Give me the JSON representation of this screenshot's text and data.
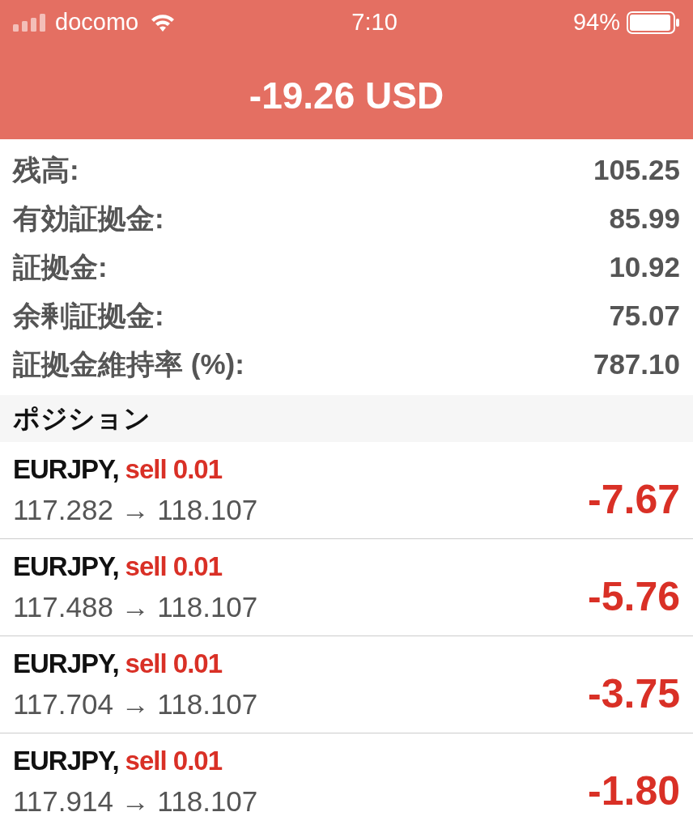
{
  "status_bar": {
    "carrier": "docomo",
    "time": "7:10",
    "battery": "94%"
  },
  "header": {
    "title": "-19.26 USD"
  },
  "summary": [
    {
      "label": "残高:",
      "value": "105.25"
    },
    {
      "label": "有効証拠金:",
      "value": "85.99"
    },
    {
      "label": "証拠金:",
      "value": "10.92"
    },
    {
      "label": "余剰証拠金:",
      "value": "75.07"
    },
    {
      "label": "証拠金維持率 (%):",
      "value": "787.10"
    }
  ],
  "section": {
    "title": "ポジション"
  },
  "positions": [
    {
      "symbol": "EURJPY,",
      "order": "sell 0.01",
      "prices": "117.282 → 118.107",
      "profit": "-7.67"
    },
    {
      "symbol": "EURJPY,",
      "order": "sell 0.01",
      "prices": "117.488 → 118.107",
      "profit": "-5.76"
    },
    {
      "symbol": "EURJPY,",
      "order": "sell 0.01",
      "prices": "117.704 → 118.107",
      "profit": "-3.75"
    },
    {
      "symbol": "EURJPY,",
      "order": "sell 0.01",
      "prices": "117.914 → 118.107",
      "profit": "-1.80"
    }
  ]
}
